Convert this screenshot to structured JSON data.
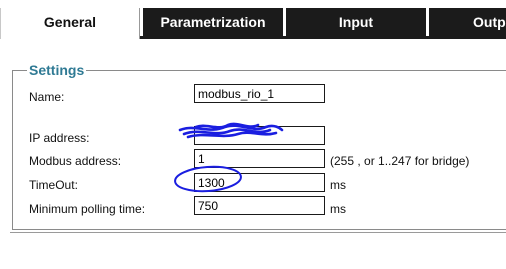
{
  "tabs": [
    {
      "label": "General",
      "active": true
    },
    {
      "label": "Parametrization",
      "active": false
    },
    {
      "label": "Input",
      "active": false
    },
    {
      "label": "Outp",
      "active": false
    }
  ],
  "settings": {
    "legend": "Settings",
    "name": {
      "label": "Name:",
      "value": "modbus_rio_1"
    },
    "ip_address": {
      "label": "IP address:",
      "value": ""
    },
    "modbus_address": {
      "label": "Modbus address:",
      "value": "1",
      "hint": "(255 , or 1..247 for bridge)"
    },
    "timeout": {
      "label": "TimeOut:",
      "value": "1300",
      "unit": "ms"
    },
    "min_polling": {
      "label": "Minimum polling time:",
      "value": "750",
      "unit": "ms"
    }
  },
  "colors": {
    "tab_dark": "#1b1b1b",
    "legend": "#2f7a94",
    "annotation_ink": "#1a1ee0"
  }
}
